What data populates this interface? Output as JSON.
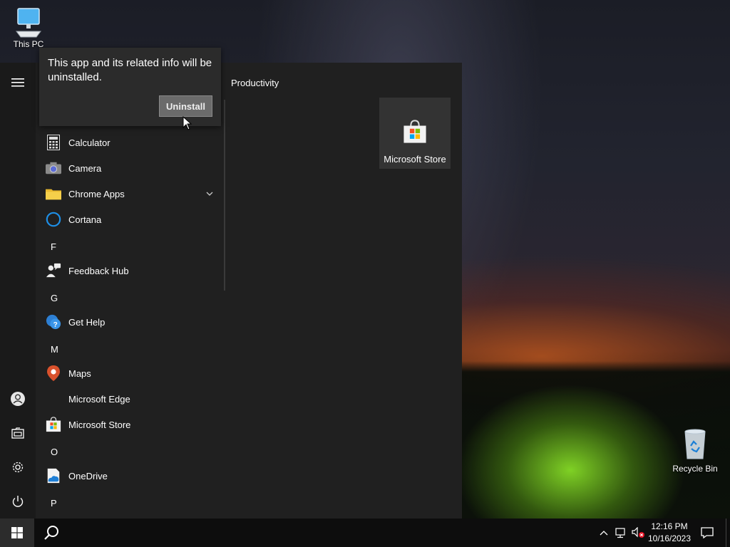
{
  "desktop": {
    "this_pc_label": "This PC",
    "recycle_bin_label": "Recycle Bin"
  },
  "start_menu": {
    "flyout": {
      "message": "This app and its related info will be uninstalled.",
      "uninstall_label": "Uninstall"
    },
    "apps": [
      {
        "label": "Calculator",
        "icon": "calculator-icon"
      },
      {
        "label": "Camera",
        "icon": "camera-icon"
      },
      {
        "label": "Chrome Apps",
        "icon": "folder-icon"
      },
      {
        "label": "Cortana",
        "icon": "cortana-icon"
      },
      {
        "label": "Feedback Hub",
        "icon": "feedback-hub-icon"
      },
      {
        "label": "Get Help",
        "icon": "get-help-icon"
      },
      {
        "label": "Maps",
        "icon": "maps-icon"
      },
      {
        "label": "Microsoft Edge",
        "icon": ""
      },
      {
        "label": "Microsoft Store",
        "icon": "microsoft-store-icon"
      },
      {
        "label": "OneDrive",
        "icon": "onedrive-icon"
      }
    ],
    "letters": {
      "f": "F",
      "g": "G",
      "m": "M",
      "o": "O",
      "p": "P"
    },
    "tiles": {
      "group_label": "Productivity",
      "store_tile_label": "Microsoft Store"
    }
  },
  "taskbar": {
    "time": "12:16 PM",
    "date": "10/16/2023"
  },
  "colors": {
    "start_bg": "#202020",
    "taskbar_bg": "#0d0d0d",
    "accent_blue": "#0078d4"
  }
}
